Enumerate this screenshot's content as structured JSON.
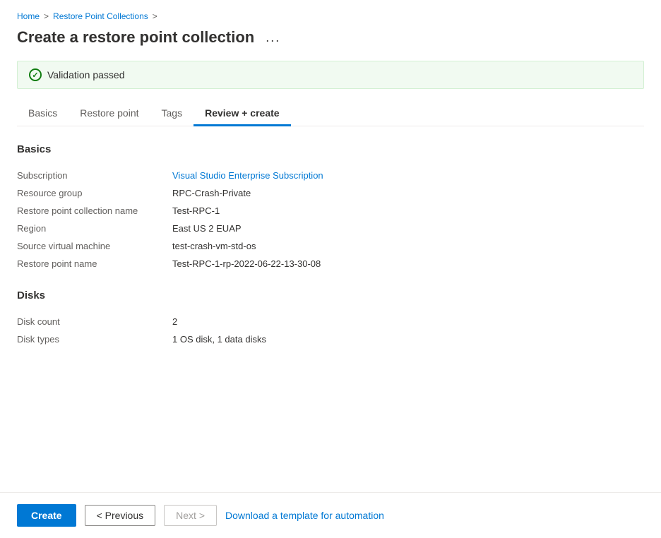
{
  "breadcrumb": {
    "home": "Home",
    "separator1": ">",
    "collections": "Restore Point Collections",
    "separator2": ">"
  },
  "page": {
    "title": "Create a restore point collection",
    "more_options_label": "..."
  },
  "validation": {
    "message": "Validation passed"
  },
  "tabs": [
    {
      "id": "basics",
      "label": "Basics",
      "active": false
    },
    {
      "id": "restore-point",
      "label": "Restore point",
      "active": false
    },
    {
      "id": "tags",
      "label": "Tags",
      "active": false
    },
    {
      "id": "review-create",
      "label": "Review + create",
      "active": true
    }
  ],
  "sections": {
    "basics": {
      "title": "Basics",
      "fields": [
        {
          "label": "Subscription",
          "value": "Visual Studio Enterprise Subscription",
          "is_link": true
        },
        {
          "label": "Resource group",
          "value": "RPC-Crash-Private"
        },
        {
          "label": "Restore point collection name",
          "value": "Test-RPC-1"
        },
        {
          "label": "Region",
          "value": "East US 2 EUAP"
        },
        {
          "label": "Source virtual machine",
          "value": "test-crash-vm-std-os"
        },
        {
          "label": "Restore point name",
          "value": "Test-RPC-1-rp-2022-06-22-13-30-08"
        }
      ]
    },
    "disks": {
      "title": "Disks",
      "fields": [
        {
          "label": "Disk count",
          "value": "2"
        },
        {
          "label": "Disk types",
          "value": "1 OS disk, 1 data disks"
        }
      ]
    }
  },
  "footer": {
    "create_label": "Create",
    "previous_label": "< Previous",
    "next_label": "Next >",
    "download_label": "Download a template for automation"
  }
}
